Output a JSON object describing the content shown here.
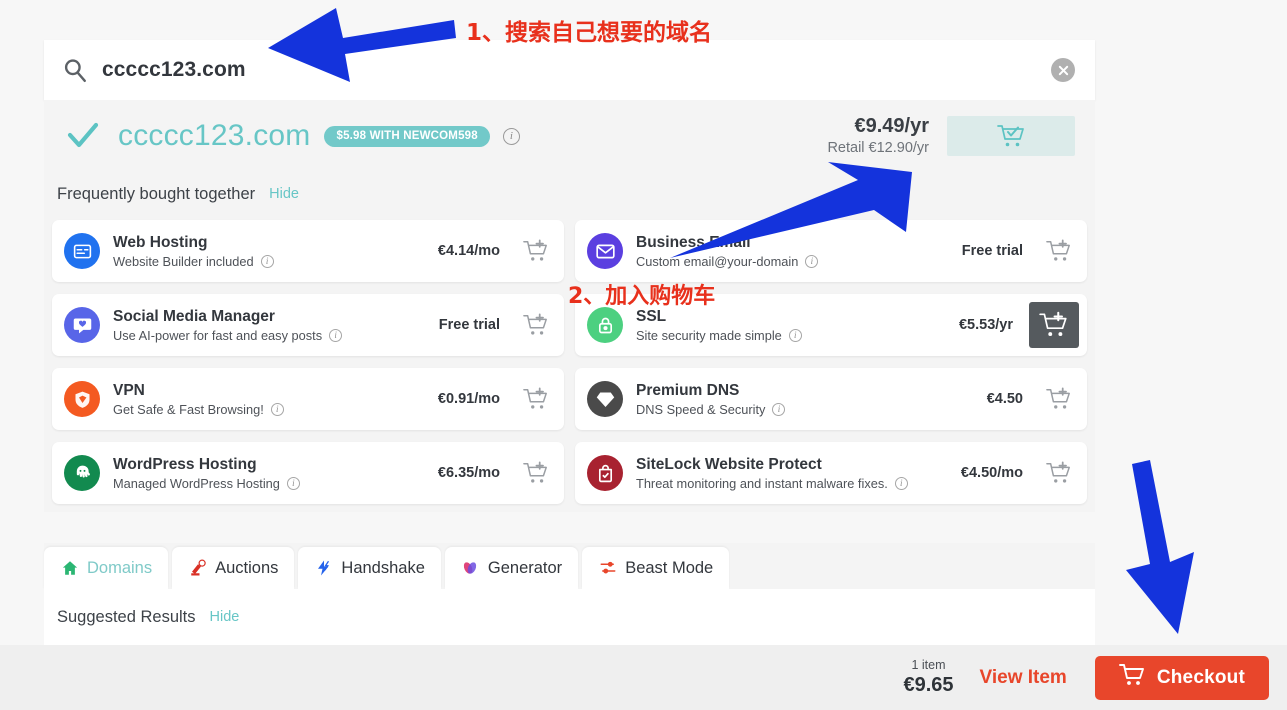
{
  "search": {
    "value": "ccccc123.com",
    "icon": "search-icon",
    "clear_icon": "close-icon"
  },
  "result": {
    "check_icon": "check-icon",
    "domain": "ccccc123.com",
    "promo_badge": "$5.98 WITH NEWCOM598",
    "info_icon": "info-icon",
    "price": "€9.49/yr",
    "retail": "Retail €12.90/yr",
    "cart_icon": "cart-check-icon"
  },
  "frequently_bought": {
    "title": "Frequently bought together",
    "hide_label": "Hide",
    "products": [
      {
        "name": "Web Hosting",
        "subtitle": "Website Builder included",
        "price": "€4.14/mo",
        "icon": "web-hosting-icon",
        "color": "#2072ef",
        "cart_state": "default"
      },
      {
        "name": "Business Email",
        "subtitle": "Custom email@your-domain",
        "price": "Free trial",
        "icon": "envelope-icon",
        "color": "#5b3fe0",
        "cart_state": "default"
      },
      {
        "name": "Social Media Manager",
        "subtitle": "Use AI-power for fast and easy posts",
        "price": "Free trial",
        "icon": "heart-chat-icon",
        "color": "#5865e8",
        "cart_state": "default"
      },
      {
        "name": "SSL",
        "subtitle": "Site security made simple",
        "price": "€5.53/yr",
        "icon": "lock-icon",
        "color": "#4cd080",
        "cart_state": "hover"
      },
      {
        "name": "VPN",
        "subtitle": "Get Safe & Fast Browsing!",
        "price": "€0.91/mo",
        "icon": "vpn-shield-icon",
        "color": "#f45a21",
        "cart_state": "default"
      },
      {
        "name": "Premium DNS",
        "subtitle": "DNS Speed & Security",
        "price": "€4.50",
        "icon": "diamond-icon",
        "color": "#4a4a4a",
        "cart_state": "default"
      },
      {
        "name": "WordPress Hosting",
        "subtitle": "Managed WordPress Hosting",
        "price": "€6.35/mo",
        "icon": "octopus-icon",
        "color": "#128a4f",
        "cart_state": "default"
      },
      {
        "name": "SiteLock Website Protect",
        "subtitle": "Threat monitoring and instant malware fixes.",
        "price": "€4.50/mo",
        "icon": "sitelock-shield-icon",
        "color": "#a82230",
        "cart_state": "default"
      }
    ]
  },
  "tabs": [
    {
      "label": "Domains",
      "icon": "home-icon",
      "active": true,
      "color": "#2bb673"
    },
    {
      "label": "Auctions",
      "icon": "auction-icon",
      "active": false,
      "color": "#d93025"
    },
    {
      "label": "Handshake",
      "icon": "handshake-icon",
      "active": false,
      "color": "#2563eb"
    },
    {
      "label": "Generator",
      "icon": "generator-icon",
      "active": false,
      "color": "#e0457b"
    },
    {
      "label": "Beast Mode",
      "icon": "sliders-icon",
      "active": false,
      "color": "#e8462b"
    }
  ],
  "suggested": {
    "title": "Suggested Results",
    "hide_label": "Hide"
  },
  "bottom_bar": {
    "item_count": "1 item",
    "total": "€9.65",
    "view_item_label": "View Item",
    "checkout_label": "Checkout",
    "checkout_icon": "cart-icon",
    "accent_color": "#e8462b"
  },
  "annotations": [
    {
      "text": "1、搜索自己想要的域名",
      "color": "#e8301c"
    },
    {
      "text": "2、加入购物车",
      "color": "#e8301c"
    }
  ],
  "arrow_color": "#1433dc"
}
